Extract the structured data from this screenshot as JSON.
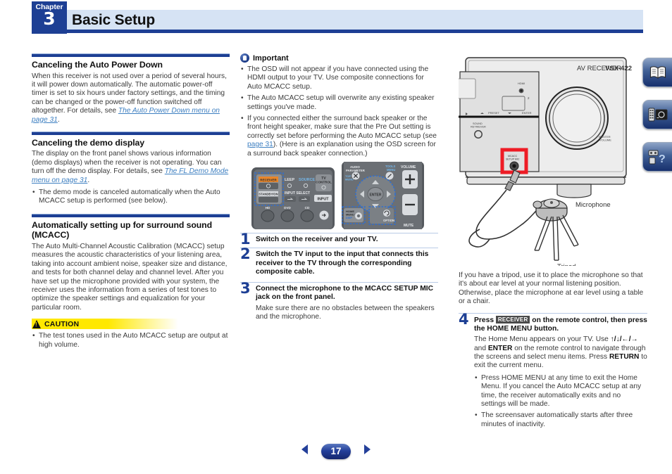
{
  "header": {
    "chapter_word": "Chapter",
    "chapter_number": "3",
    "title": "Basic Setup"
  },
  "colors": {
    "brand_blue": "#1d3f94",
    "band_blue": "#d6e3f4",
    "link_blue": "#3d7fc1",
    "caution_yellow": "#ffe800",
    "highlight_red": "#ee1c25"
  },
  "left_column": {
    "section1": {
      "heading": "Canceling the Auto Power Down",
      "paragraph_pre": "When this receiver is not used over a period of several hours, it will power down automatically. The automatic power-off timer is set to six hours under factory settings, and the timing can be changed or the power-off function switched off altogether. For details, see ",
      "link": "The Auto Power Down menu on page 31",
      "paragraph_post": "."
    },
    "section2": {
      "heading": "Canceling the demo display",
      "paragraph_pre": "The display on the front panel shows various information (demo displays) when the receiver is not operating. You can turn off the demo display. For details, see ",
      "link": "The FL Demo Mode menu on page 31",
      "paragraph_post": ".",
      "bullets": [
        "The demo mode is canceled automatically when the Auto MCACC setup is performed (see below)."
      ]
    },
    "section3": {
      "heading": "Automatically setting up for surround sound (MCACC)",
      "paragraph": "The Auto Multi-Channel Acoustic Calibration (MCACC) setup measures the acoustic characteristics of your listening area, taking into account ambient noise, speaker size and distance, and tests for both channel delay and channel level. After you have set up the microphone provided with your system, the receiver uses the information from a series of test tones to optimize the speaker settings and equalization for your particular room.",
      "caution_label": "CAUTION",
      "caution_bullets": [
        "The test tones used in the Auto MCACC setup are output at high volume."
      ]
    }
  },
  "middle_column": {
    "important_label": "Important",
    "important_bullets": [
      "The OSD will not appear if you have connected using the HDMI output to your TV. Use composite connections for Auto MCACC setup.",
      "The Auto MCACC setup will overwrite any existing speaker settings you've made."
    ],
    "important_bullet3_pre": "If you connected either the surround back speaker or the front height speaker, make sure that the Pre Out setting is correctly set before performing the Auto MCACC setup (see ",
    "important_bullet3_link": "page 31",
    "important_bullet3_post": "). (Here is an explanation using the OSD screen for a surround back speaker connection.)",
    "remote_labels": {
      "receiver": "RECEIVER",
      "standby": "STANDBY/ON",
      "sleep": "SLEEP",
      "source": "SOURCE",
      "tv_control": "TV CONTROL",
      "input_select": "INPUT SELECT",
      "input": "INPUT",
      "hdd": "HD",
      "dvd": "DVD",
      "cd": "CD",
      "audio_parameter": "AUDIO PARAMETER",
      "top_menu": "TOP MENU",
      "tools_menu": "TOOLS MENU",
      "enter": "ENTER",
      "volume": "VOLUME",
      "mute": "MUTE",
      "home_menu": "HOME MENU",
      "return": "RETURN",
      "option": "OPTION"
    },
    "steps": [
      {
        "number": "1",
        "title": "Switch on the receiver and your TV.",
        "body": ""
      },
      {
        "number": "2",
        "title": "Switch the TV input to the input that connects this receiver to the TV through the corresponding composite cable.",
        "body": ""
      },
      {
        "number": "3",
        "title": "Connect the microphone to the MCACC SETUP MIC jack on the front panel.",
        "body": "Make sure there are no obstacles between the speakers and the microphone."
      }
    ]
  },
  "right_column": {
    "receiver_brand": "AV RECEIVER",
    "receiver_model": "VSX-422",
    "receiver_labels": {
      "hdmi": "HDMI",
      "preset": "PRESET",
      "enter": "ENTER",
      "sound_retriever": "SOUND RETRIEVER",
      "mcacc_setup_mic": "MCACC SETUP MIC",
      "master_volume": "MASTER VOLUME"
    },
    "callouts": {
      "microphone": "Microphone",
      "tripod": "Tripod"
    },
    "tripod_paragraph": "If you have a tripod, use it to place the microphone so that it's about ear level at your normal listening position. Otherwise, place the microphone at ear level using a table or a chair.",
    "step4": {
      "number": "4",
      "title_pre": "Press ",
      "keycap": "RECEIVER",
      "title_post": " on the remote control, then press the HOME MENU button.",
      "body_pre": "The Home Menu appears on your TV. Use ",
      "body_arrows": "↑/↓/←/→",
      "body_mid": " and ",
      "body_enter": "ENTER",
      "body_mid2": " on the remote control to navigate through the screens and select menu items. Press ",
      "body_return": "RETURN",
      "body_post": " to exit the current menu.",
      "bullets": [
        "Press HOME MENU at any time to exit the Home Menu. If you cancel the Auto MCACC setup at any time, the receiver automatically exits and no settings will be made.",
        "The screensaver automatically starts after three minutes of inactivity."
      ]
    }
  },
  "sidetabs": [
    {
      "name": "book-icon",
      "title": ""
    },
    {
      "name": "remote-icon",
      "title": ""
    },
    {
      "name": "faq-icon",
      "title": ""
    }
  ],
  "footer": {
    "prev_icon": "triangle-left-icon",
    "page_number": "17",
    "next_icon": "triangle-right-icon"
  }
}
